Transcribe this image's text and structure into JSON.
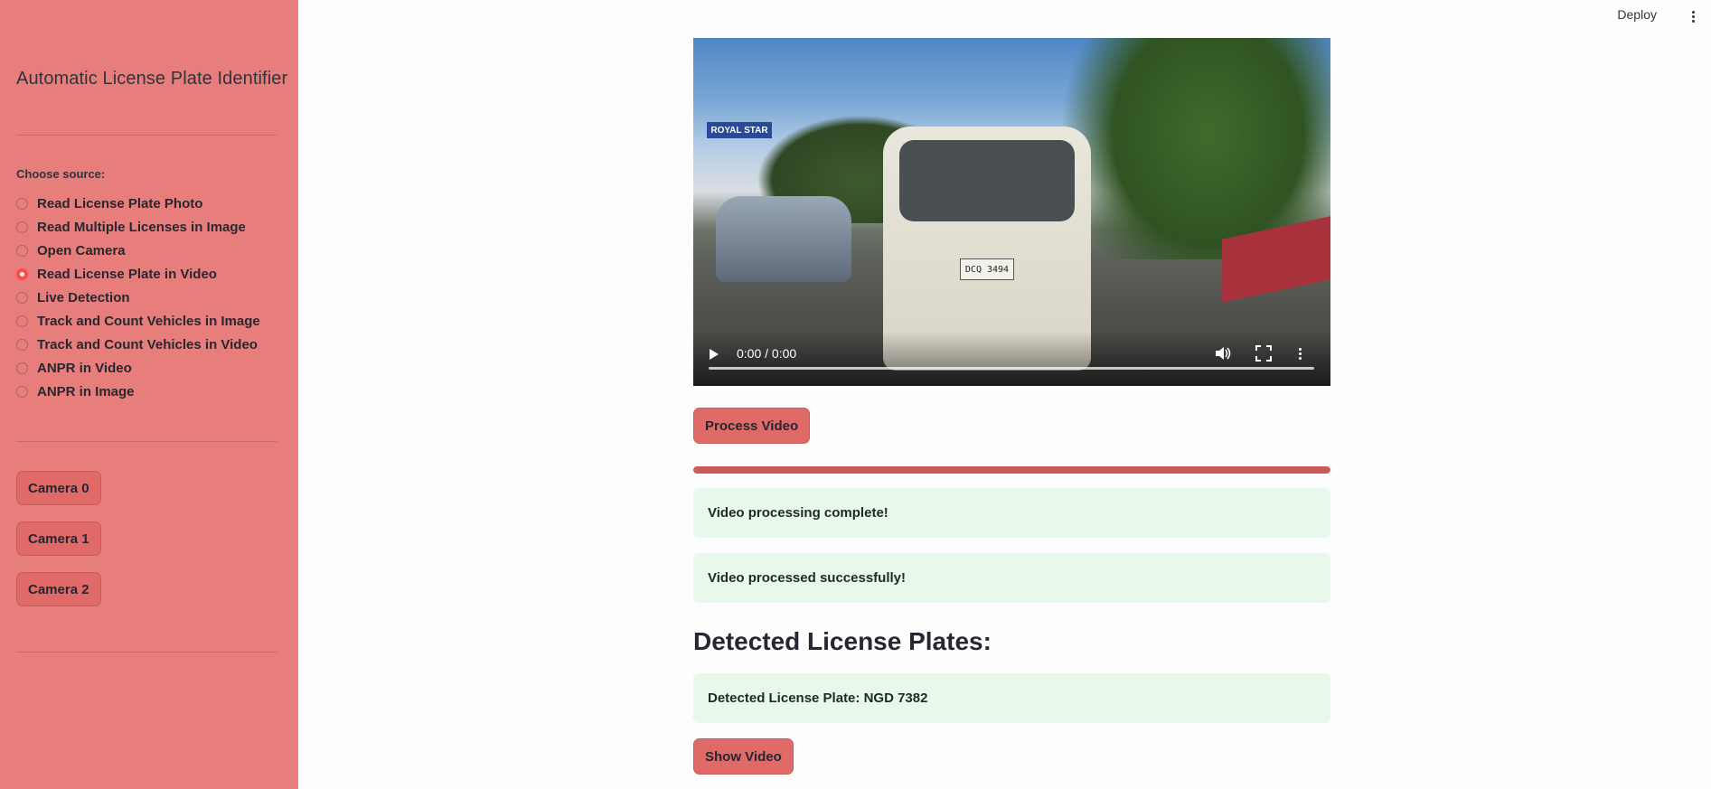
{
  "sidebar": {
    "title": "Automatic License Plate Identifier",
    "source_label": "Choose source:",
    "options": [
      {
        "label": "Read License Plate Photo",
        "selected": false
      },
      {
        "label": "Read Multiple Licenses in Image",
        "selected": false
      },
      {
        "label": "Open Camera",
        "selected": false
      },
      {
        "label": "Read License Plate in Video",
        "selected": true
      },
      {
        "label": "Live Detection",
        "selected": false
      },
      {
        "label": "Track and Count Vehicles in Image",
        "selected": false
      },
      {
        "label": "Track and Count Vehicles in Video",
        "selected": false
      },
      {
        "label": "ANPR in Video",
        "selected": false
      },
      {
        "label": "ANPR in Image",
        "selected": false
      }
    ],
    "camera_buttons": [
      "Camera 0",
      "Camera 1",
      "Camera 2"
    ]
  },
  "toolbar": {
    "deploy_label": "Deploy",
    "menu_icon": "kebab-menu-icon"
  },
  "video": {
    "time": "0:00 / 0:00",
    "scene_text": {
      "shop_sign": "ROYAL STAR",
      "van_plate": "DCQ 3494"
    }
  },
  "actions": {
    "process_label": "Process Video",
    "show_label": "Show Video"
  },
  "progress": {
    "value": 1.0
  },
  "alerts": {
    "processing_complete": "Video processing complete!",
    "processed_success": "Video processed successfully!",
    "detected_plate": "Detected License Plate: NGD 7382"
  },
  "results": {
    "heading": "Detected License Plates:"
  },
  "colors": {
    "sidebar_bg": "#e87e7b",
    "button_bg": "#e06a67",
    "success_bg": "#e8f8ea",
    "progress_fill": "#c95b5b",
    "accent": "#ff4b4b"
  }
}
